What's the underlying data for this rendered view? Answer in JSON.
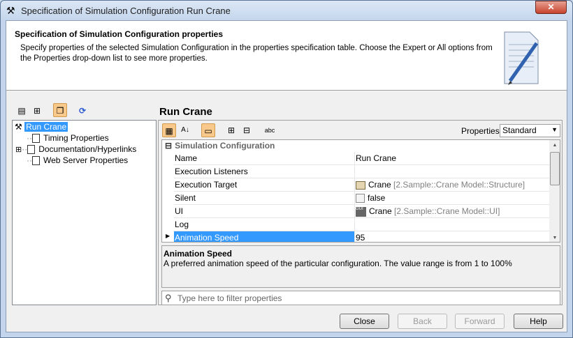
{
  "window": {
    "title": "Specification of Simulation Configuration Run Crane"
  },
  "header": {
    "title": "Specification of Simulation Configuration properties",
    "description": "Specify properties of the selected Simulation Configuration in the properties specification table. Choose the Expert or All options from the Properties drop-down list to see more properties."
  },
  "tree": {
    "root": "Run Crane",
    "items": [
      {
        "label": "Timing Properties"
      },
      {
        "label": "Documentation/Hyperlinks",
        "expandable": true
      },
      {
        "label": "Web Server Properties"
      }
    ]
  },
  "panel": {
    "title": "Run Crane",
    "properties_label": "Properties:",
    "properties_value": "Standard"
  },
  "table": {
    "group": "Simulation Configuration",
    "rows": [
      {
        "name": "Name",
        "value": "Run Crane",
        "qualifier": ""
      },
      {
        "name": "Execution Listeners",
        "value": "",
        "qualifier": ""
      },
      {
        "name": "Execution Target",
        "value": "Crane",
        "qualifier": "[2.Sample::Crane Model::Structure]"
      },
      {
        "name": "Silent",
        "value": "false",
        "qualifier": ""
      },
      {
        "name": "UI",
        "value": "Crane",
        "qualifier": "[2.Sample::Crane Model::UI]"
      },
      {
        "name": "Log",
        "value": "",
        "qualifier": ""
      },
      {
        "name": "Animation Speed",
        "value": "95",
        "qualifier": ""
      }
    ]
  },
  "description": {
    "title": "Animation Speed",
    "text": "A preferred animation speed of the particular configuration. The value range is from 1 to 100%"
  },
  "filter": {
    "placeholder": "Type here to filter properties"
  },
  "buttons": {
    "close": "Close",
    "back": "Back",
    "forward": "Forward",
    "help": "Help"
  }
}
